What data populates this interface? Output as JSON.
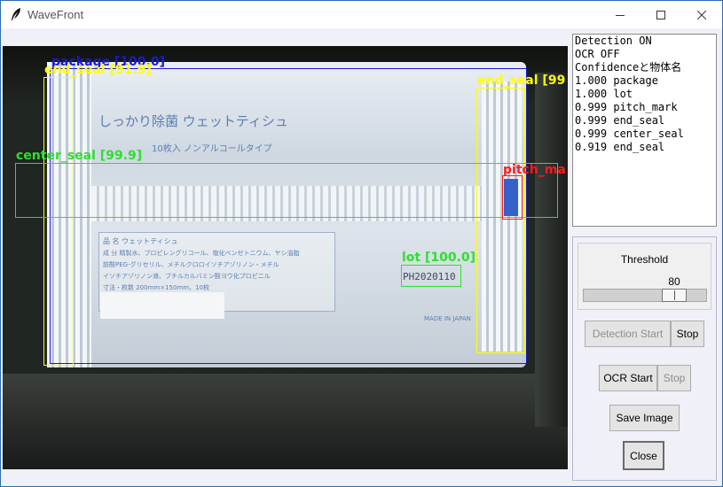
{
  "window": {
    "title": "WaveFront",
    "icon": "feather-icon",
    "controls": [
      "minimize-icon",
      "maximize-icon",
      "close-icon"
    ]
  },
  "video": {
    "package_text": {
      "brand_line": "しっかり除菌 ウェットティシュ",
      "sub_line": "10枚入 ノンアルコールタイプ",
      "lot_print": "PH2020110",
      "label_lines": [
        "品 名 ウェットティシュ",
        "成 分 精製水、プロピレングリコール、塩化ベンゼトニウム、ヤシ油脂",
        "肪酸PEG-グリセリル、メチルクロロイソチアゾリノン・メチル",
        "イソチアゾリノン液、ブチルカルバミン酸ヨウ化プロピニル",
        "寸法・枚数 200mm×150mm、10枚"
      ],
      "made_in": "MADE IN JAPAN"
    },
    "detections": [
      {
        "name": "package",
        "label": "package [100.0]",
        "color": "#1a1ad0"
      },
      {
        "name": "end-seal-left",
        "label": "end_seal [91.9]",
        "color": "#ffff00"
      },
      {
        "name": "end-seal-right",
        "label": "end_seal [99",
        "color": "#ffff00"
      },
      {
        "name": "center-seal",
        "label": "center_seal [99.9]",
        "color": "#2ee02e"
      },
      {
        "name": "pitch-mark",
        "label": "pitch_ma",
        "color": "#ff1a1a"
      },
      {
        "name": "lot",
        "label": "lot [100.0]",
        "color": "#2ee02e"
      }
    ]
  },
  "status": {
    "lines": [
      "Detection ON",
      "OCR OFF",
      "",
      "Confidenceと物体名",
      "1.000 package",
      "1.000 lot",
      "0.999 pitch_mark",
      "0.999 end_seal",
      "0.999 center_seal",
      "0.919 end_seal"
    ]
  },
  "threshold": {
    "label": "Threshold",
    "value": "80",
    "level": 80
  },
  "buttons": {
    "detection_start": "Detection Start",
    "detection_stop": "Stop",
    "ocr_start": "OCR Start",
    "ocr_stop": "Stop",
    "save_image": "Save Image",
    "close": "Close"
  }
}
